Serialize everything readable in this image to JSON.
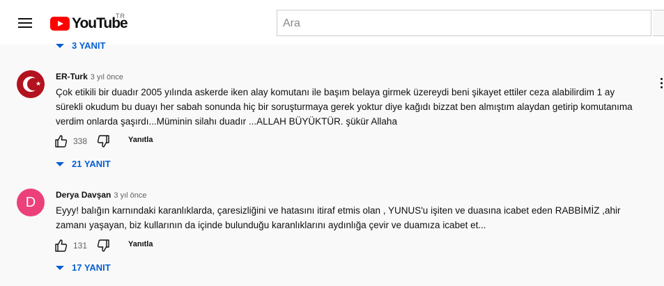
{
  "header": {
    "logo_text": "YouTube",
    "region": "TR",
    "search_placeholder": "Ara"
  },
  "top_replies": {
    "label": "3 YANIT"
  },
  "comments": [
    {
      "author": "ER-Turk",
      "time": "3 yıl önce",
      "text": "Çok etikili bir duadır 2005 yılında askerde iken alay komutanı ile başım belaya girmek üzereydi beni şikayet ettiler ceza alabilirdim 1 ay sürekli okudum bu duayı her sabah sonunda hiç bir soruşturmaya gerek yoktur diye kağıdı bizzat ben almıştım alaydan getirip komutanıma verdim onlarda şaşırdı...Müminin silahı duadır ...ALLAH BÜYÜKTÜR. şükür Allaha",
      "likes": "338",
      "reply_label": "Yanıtla",
      "replies_label": "21 YANIT"
    },
    {
      "author": "Derya Davşan",
      "time": "3 yıl önce",
      "avatar_letter": "D",
      "text": "Eyyy! balığın karnındaki karanlıklarda, çaresizliğini ve hatasını itiraf etmis olan , YUNUS'u işiten ve duasına icabet eden RABBİMİZ ,ahir zamanı yaşayan,  biz kullarının da içinde bulunduğu karanlıklarını aydınlığa çevir ve duamıza icabet et...",
      "likes": "131",
      "reply_label": "Yanıtla",
      "replies_label": "17 YANIT"
    }
  ],
  "colors": {
    "link_blue": "#065fd4",
    "logo_red": "#ff0000",
    "avatar_pink": "#ec407a",
    "avatar_red": "#b3121f"
  }
}
